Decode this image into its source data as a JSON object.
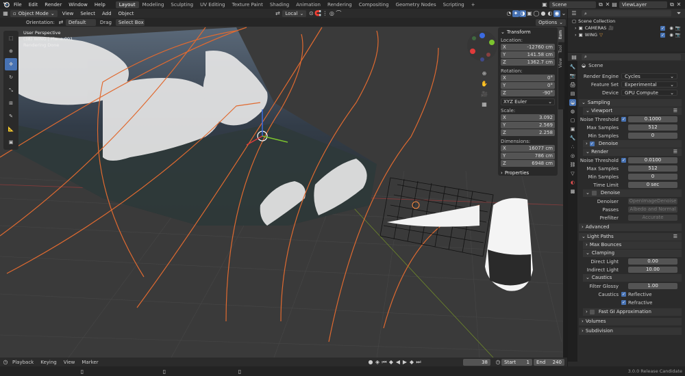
{
  "menu": [
    "File",
    "Edit",
    "Render",
    "Window",
    "Help"
  ],
  "workspaces": [
    "Layout",
    "Modeling",
    "Sculpting",
    "UV Editing",
    "Texture Paint",
    "Shading",
    "Animation",
    "Rendering",
    "Compositing",
    "Geometry Nodes",
    "Scripting"
  ],
  "active_workspace": "Layout",
  "scene_name": "Scene",
  "view_layer": "ViewLayer",
  "viewport_header": {
    "mode": "Object Mode",
    "items": [
      "View",
      "Select",
      "Add",
      "Object"
    ],
    "transform_orientation": "Local"
  },
  "tool_header": {
    "orientation_label": "Orientation:",
    "orientation_value": "Default",
    "drag_label": "Drag",
    "drag_value": "Select Box",
    "options_label": "Options"
  },
  "viewport_info": {
    "line1": "User Perspective",
    "line2": "(38) WING | Plane.001",
    "line3": "Rendering Done"
  },
  "n_panel": {
    "title": "Transform",
    "location_label": "Location:",
    "location": [
      {
        "axis": "X",
        "value": "-12760 cm"
      },
      {
        "axis": "Y",
        "value": "141.58 cm"
      },
      {
        "axis": "Z",
        "value": "1362.7 cm"
      }
    ],
    "rotation_label": "Rotation:",
    "rotation": [
      {
        "axis": "X",
        "value": "0°"
      },
      {
        "axis": "Y",
        "value": "0°"
      },
      {
        "axis": "Z",
        "value": "-90°"
      }
    ],
    "rotation_mode": "XYZ Euler",
    "scale_label": "Scale:",
    "scale": [
      {
        "axis": "X",
        "value": "3.092"
      },
      {
        "axis": "Y",
        "value": "2.569"
      },
      {
        "axis": "Z",
        "value": "2.258"
      }
    ],
    "dimensions_label": "Dimensions:",
    "dimensions": [
      {
        "axis": "X",
        "value": "16077 cm"
      },
      {
        "axis": "Y",
        "value": "786 cm"
      },
      {
        "axis": "Z",
        "value": "6948 cm"
      }
    ],
    "properties_label": "Properties",
    "tabs": [
      "Item",
      "Tool",
      "View"
    ]
  },
  "outliner": {
    "title": "Scene Collection",
    "rows": [
      {
        "name": "CAMERAS"
      },
      {
        "name": "WING"
      }
    ]
  },
  "properties": {
    "context": "Scene",
    "render_engine_label": "Render Engine",
    "render_engine": "Cycles",
    "feature_set_label": "Feature Set",
    "feature_set": "Experimental",
    "device_label": "Device",
    "device": "GPU Compute",
    "sampling": "Sampling",
    "viewport": "Viewport",
    "noise_threshold_label": "Noise Threshold",
    "vp_noise_threshold": "0.1000",
    "max_samples_label": "Max Samples",
    "vp_max_samples": "512",
    "min_samples_label": "Min Samples",
    "vp_min_samples": "0",
    "denoise": "Denoise",
    "render": "Render",
    "r_noise_threshold": "0.0100",
    "r_max_samples": "512",
    "r_min_samples": "0",
    "time_limit_label": "Time Limit",
    "time_limit": "0 sec",
    "denoise2": "Denoise",
    "denoiser_label": "Denoiser",
    "denoiser": "OpenImageDenoise",
    "passes_label": "Passes",
    "passes": "Albedo and Normal",
    "prefilter_label": "Prefilter",
    "prefilter": "Accurate",
    "advanced": "Advanced",
    "light_paths": "Light Paths",
    "max_bounces": "Max Bounces",
    "clamping": "Clamping",
    "direct_light_label": "Direct Light",
    "direct_light": "0.00",
    "indirect_light_label": "Indirect Light",
    "indirect_light": "10.00",
    "caustics": "Caustics",
    "filter_glossy_label": "Filter Glossy",
    "filter_glossy": "1.00",
    "caustics_label": "Caustics",
    "reflective": "Reflective",
    "refractive": "Refractive",
    "fast_gi": "Fast GI Approximation",
    "volumes": "Volumes",
    "subdivision": "Subdivision"
  },
  "timeline": {
    "items": [
      "Playback",
      "Keying",
      "View",
      "Marker"
    ],
    "current_frame": "38",
    "start_label": "Start",
    "start": "1",
    "end_label": "End",
    "end": "240"
  },
  "status": {
    "version": "3.0.0 Release Candidate"
  }
}
